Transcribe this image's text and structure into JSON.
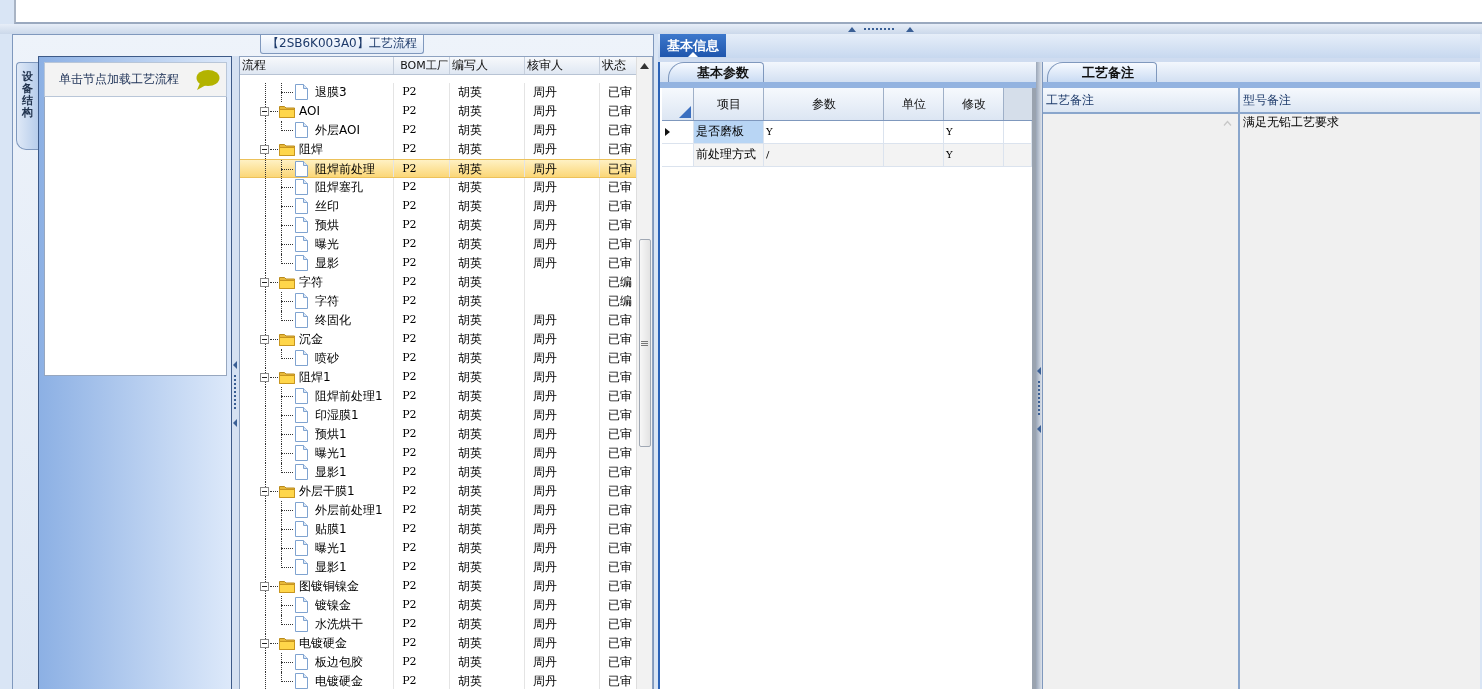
{
  "process_panel": {
    "title": "【2SB6K003A0】工艺流程",
    "side_tab": "设备结构",
    "node_hint": "单击节点加载工艺流程",
    "tree_grid": {
      "columns": [
        "流程",
        "BOM工厂",
        "编写人",
        "核审人",
        "状态"
      ],
      "rows": [
        {
          "kind": "leaf",
          "name": "退膜3",
          "factory": "P2",
          "writer": "胡英",
          "reviewer": "周丹",
          "status": "已审",
          "selected": false
        },
        {
          "kind": "folder",
          "name": "AOI",
          "factory": "P2",
          "writer": "胡英",
          "reviewer": "周丹",
          "status": "已审",
          "selected": false,
          "expanded": true,
          "children": [
            {
              "kind": "leaf",
              "name": "外层AOI",
              "factory": "P2",
              "writer": "胡英",
              "reviewer": "周丹",
              "status": "已审",
              "selected": false
            }
          ]
        },
        {
          "kind": "folder",
          "name": "阻焊",
          "factory": "P2",
          "writer": "胡英",
          "reviewer": "周丹",
          "status": "已审",
          "selected": false,
          "expanded": true,
          "children": [
            {
              "kind": "leaf",
              "name": "阻焊前处理",
              "factory": "P2",
              "writer": "胡英",
              "reviewer": "周丹",
              "status": "已审",
              "selected": true
            },
            {
              "kind": "leaf",
              "name": "阻焊塞孔",
              "factory": "P2",
              "writer": "胡英",
              "reviewer": "周丹",
              "status": "已审",
              "selected": false
            },
            {
              "kind": "leaf",
              "name": "丝印",
              "factory": "P2",
              "writer": "胡英",
              "reviewer": "周丹",
              "status": "已审",
              "selected": false
            },
            {
              "kind": "leaf",
              "name": "预烘",
              "factory": "P2",
              "writer": "胡英",
              "reviewer": "周丹",
              "status": "已审",
              "selected": false
            },
            {
              "kind": "leaf",
              "name": "曝光",
              "factory": "P2",
              "writer": "胡英",
              "reviewer": "周丹",
              "status": "已审",
              "selected": false
            },
            {
              "kind": "leaf",
              "name": "显影",
              "factory": "P2",
              "writer": "胡英",
              "reviewer": "周丹",
              "status": "已审",
              "selected": false
            }
          ]
        },
        {
          "kind": "folder",
          "name": "字符",
          "factory": "P2",
          "writer": "胡英",
          "status": "已编",
          "selected": false,
          "expanded": true,
          "children": [
            {
              "kind": "leaf",
              "name": "字符",
              "factory": "P2",
              "writer": "胡英",
              "status": "已编",
              "selected": false
            },
            {
              "kind": "leaf",
              "name": "终固化",
              "factory": "P2",
              "writer": "胡英",
              "reviewer": "周丹",
              "status": "已审",
              "selected": false
            }
          ]
        },
        {
          "kind": "folder",
          "name": "沉金",
          "factory": "P2",
          "writer": "胡英",
          "reviewer": "周丹",
          "status": "已审",
          "selected": false,
          "expanded": true,
          "children": [
            {
              "kind": "leaf",
              "name": "喷砂",
              "factory": "P2",
              "writer": "胡英",
              "reviewer": "周丹",
              "status": "已审",
              "selected": false
            }
          ]
        },
        {
          "kind": "folder",
          "name": "阻焊1",
          "factory": "P2",
          "writer": "胡英",
          "reviewer": "周丹",
          "status": "已审",
          "selected": false,
          "expanded": true,
          "children": [
            {
              "kind": "leaf",
              "name": "阻焊前处理1",
              "factory": "P2",
              "writer": "胡英",
              "reviewer": "周丹",
              "status": "已审",
              "selected": false
            },
            {
              "kind": "leaf",
              "name": "印湿膜1",
              "factory": "P2",
              "writer": "胡英",
              "reviewer": "周丹",
              "status": "已审",
              "selected": false
            },
            {
              "kind": "leaf",
              "name": "预烘1",
              "factory": "P2",
              "writer": "胡英",
              "reviewer": "周丹",
              "status": "已审",
              "selected": false
            },
            {
              "kind": "leaf",
              "name": "曝光1",
              "factory": "P2",
              "writer": "胡英",
              "reviewer": "周丹",
              "status": "已审",
              "selected": false
            },
            {
              "kind": "leaf",
              "name": "显影1",
              "factory": "P2",
              "writer": "胡英",
              "reviewer": "周丹",
              "status": "已审",
              "selected": false
            }
          ]
        },
        {
          "kind": "folder",
          "name": "外层干膜1",
          "factory": "P2",
          "writer": "胡英",
          "reviewer": "周丹",
          "status": "已审",
          "selected": false,
          "expanded": true,
          "children": [
            {
              "kind": "leaf",
              "name": "外层前处理1",
              "factory": "P2",
              "writer": "胡英",
              "reviewer": "周丹",
              "status": "已审",
              "selected": false
            },
            {
              "kind": "leaf",
              "name": "贴膜1",
              "factory": "P2",
              "writer": "胡英",
              "reviewer": "周丹",
              "status": "已审",
              "selected": false
            },
            {
              "kind": "leaf",
              "name": "曝光1",
              "factory": "P2",
              "writer": "胡英",
              "reviewer": "周丹",
              "status": "已审",
              "selected": false
            },
            {
              "kind": "leaf",
              "name": "显影1",
              "factory": "P2",
              "writer": "胡英",
              "reviewer": "周丹",
              "status": "已审",
              "selected": false
            }
          ]
        },
        {
          "kind": "folder",
          "name": "图镀铜镍金",
          "factory": "P2",
          "writer": "胡英",
          "reviewer": "周丹",
          "status": "已审",
          "selected": false,
          "expanded": true,
          "children": [
            {
              "kind": "leaf",
              "name": "镀镍金",
              "factory": "P2",
              "writer": "胡英",
              "reviewer": "周丹",
              "status": "已审",
              "selected": false
            },
            {
              "kind": "leaf",
              "name": "水洗烘干",
              "factory": "P2",
              "writer": "胡英",
              "reviewer": "周丹",
              "status": "已审",
              "selected": false
            }
          ]
        },
        {
          "kind": "folder",
          "name": "电镀硬金",
          "factory": "P2",
          "writer": "胡英",
          "reviewer": "周丹",
          "status": "已审",
          "selected": false,
          "expanded": true,
          "children": [
            {
              "kind": "leaf",
              "name": "板边包胶",
              "factory": "P2",
              "writer": "胡英",
              "reviewer": "周丹",
              "status": "已审",
              "selected": false
            },
            {
              "kind": "leaf",
              "name": "电镀硬金",
              "factory": "P2",
              "writer": "胡英",
              "reviewer": "周丹",
              "status": "已审",
              "selected": false
            }
          ]
        }
      ]
    }
  },
  "detail": {
    "tabs": [
      {
        "label": "基本信息",
        "selected": true
      }
    ],
    "params": {
      "tab": "基本参数",
      "columns": [
        "项目",
        "参数",
        "单位",
        "修改"
      ],
      "rows": [
        {
          "item": "是否磨板",
          "value": "Y",
          "modify": "Y",
          "current": true,
          "selected": true
        },
        {
          "item": "前处理方式",
          "value": "/",
          "modify": "Y",
          "current": false,
          "selected": false
        }
      ]
    },
    "notes": {
      "tab": "工艺备注",
      "columns": [
        "工艺备注",
        "型号备注"
      ],
      "rows": [
        {
          "model_note": "满足无铅工艺要求"
        }
      ]
    }
  }
}
